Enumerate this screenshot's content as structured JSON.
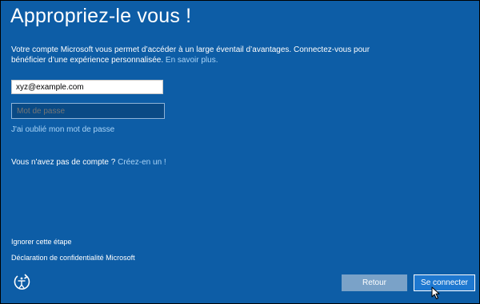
{
  "title": "Appropriez-le vous !",
  "description": {
    "text": "Votre compte Microsoft vous permet d’accéder à un large éventail d’avantages. Connectez-vous pour bénéficier d’une expérience personnalisée. ",
    "link": "En savoir plus."
  },
  "email": {
    "value": "xyz@example.com"
  },
  "password": {
    "placeholder": "Mot de passe"
  },
  "forgot_link": "J'ai oublié mon mot de passe",
  "no_account": {
    "text": "Vous n'avez pas de compte ? ",
    "link": "Créez-en un !"
  },
  "footer": {
    "skip": "Ignorer cette étape",
    "privacy": "Déclaration de confidentialité Microsoft"
  },
  "buttons": {
    "back": "Retour",
    "connect": "Se connecter"
  },
  "icons": {
    "accessibility": "ease-of-access-icon",
    "cursor": "mouse-pointer-icon"
  },
  "colors": {
    "background": "#0d5da6",
    "link": "#a9d4f7",
    "primary_button": "#1e78d0",
    "secondary_button": "#7aa2c8"
  }
}
